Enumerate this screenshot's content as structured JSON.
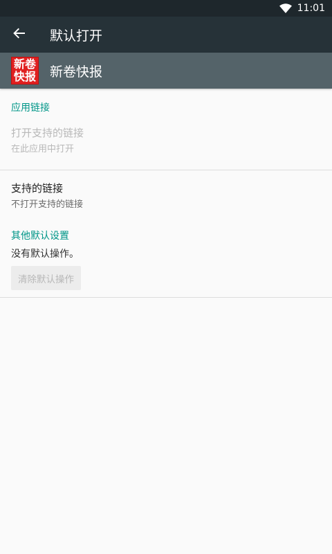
{
  "status_bar": {
    "time": "11:01",
    "wifi_icon": "wifi-icon"
  },
  "toolbar": {
    "title": "默认打开",
    "back_icon": "back-arrow-icon"
  },
  "app": {
    "name": "新卷快报",
    "icon_line1": "新卷",
    "icon_line2": "快报",
    "icon_color": "#e02020"
  },
  "sections": {
    "app_links": {
      "title": "应用链接",
      "open_supported": {
        "title": "打开支持的链接",
        "summary": "在此应用中打开"
      },
      "supported_links": {
        "title": "支持的链接",
        "summary": "不打开支持的链接"
      }
    },
    "other_defaults": {
      "title": "其他默认设置",
      "no_defaults": "没有默认操作。",
      "clear_button": "清除默认操作"
    }
  },
  "colors": {
    "accent": "#009688",
    "toolbar": "#263238",
    "app_header": "#546369"
  }
}
